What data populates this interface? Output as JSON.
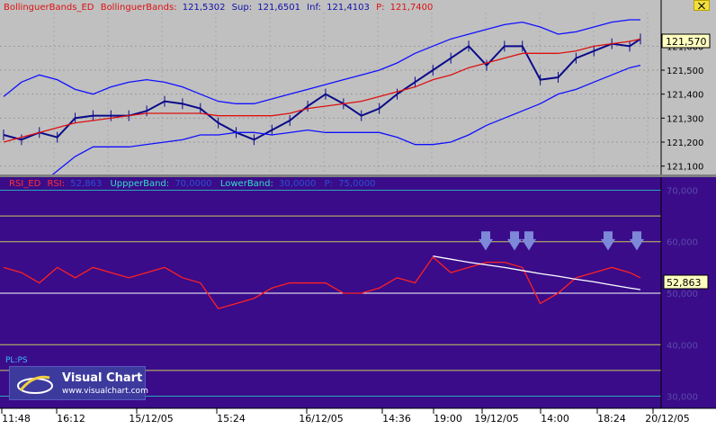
{
  "upper_panel": {
    "legend": {
      "indicator": "BollinguerBands_ED",
      "name": "BollinguerBands:",
      "value": "121,5302",
      "sup_label": "Sup:",
      "sup_value": "121,6501",
      "inf_label": "Inf:",
      "inf_value": "121,4103",
      "p_label": "P:",
      "p_value": "121,7400"
    },
    "price_tag": "121,570",
    "y_ticks": [
      "121,600",
      "121,500",
      "121,400",
      "121,300",
      "121,200",
      "121,100"
    ]
  },
  "lower_panel": {
    "legend": {
      "indicator": "RSI_ED",
      "name": "RSI:",
      "value": "52,863",
      "upper_label": "UppperBand:",
      "upper_value": "70,0000",
      "lower_label": "LowerBand:",
      "lower_value": "30,0000",
      "p_label": "P:",
      "p_value": "75,0000"
    },
    "value_tag": "52,863",
    "y_ticks": [
      "70,000",
      "60,000",
      "50,000",
      "40,000",
      "30,000"
    ],
    "pl_label": "PL:PS"
  },
  "x_ticks": [
    "11:48",
    "16:12",
    "15/12/05",
    "15:24",
    "16/12/05",
    "14:36",
    "19:00",
    "19/12/05",
    "14:00",
    "18:24",
    "20/12/05"
  ],
  "logo": {
    "title": "Visual Chart",
    "url": "www.visualchart.com"
  },
  "colors": {
    "upper_bg": "#c0c0c0",
    "lower_bg": "#3a0c8a",
    "price": "#0a0a8a",
    "bands": "#1010ff",
    "mid": "#dd1010",
    "rsi": "#ff2020",
    "level_gold": "#c8c860",
    "level_white": "#ffffff",
    "level_cyan": "#2aa8b8",
    "trend": "#ffffff",
    "arrow": "#7d88d8",
    "tag_bg": "#ffffc0"
  },
  "chart_data": [
    {
      "type": "line",
      "title": "BollinguerBands_ED",
      "ylim": [
        121.08,
        121.74
      ],
      "x": [
        0,
        20,
        40,
        60,
        80,
        100,
        120,
        140,
        160,
        180,
        200,
        220,
        240,
        260,
        280,
        300,
        320,
        340,
        360,
        380,
        400,
        420,
        440,
        460,
        480,
        500,
        520,
        540,
        560,
        580,
        600,
        620,
        640,
        660,
        680,
        700,
        712
      ],
      "series": [
        {
          "name": "Price",
          "values": [
            121.23,
            121.21,
            121.24,
            121.22,
            121.3,
            121.31,
            121.31,
            121.31,
            121.33,
            121.37,
            121.36,
            121.34,
            121.28,
            121.24,
            121.21,
            121.25,
            121.29,
            121.35,
            121.4,
            121.36,
            121.31,
            121.34,
            121.4,
            121.45,
            121.5,
            121.55,
            121.6,
            121.52,
            121.6,
            121.6,
            121.46,
            121.47,
            121.55,
            121.58,
            121.61,
            121.6,
            121.63
          ]
        },
        {
          "name": "Sup",
          "values": [
            121.39,
            121.45,
            121.48,
            121.46,
            121.42,
            121.4,
            121.43,
            121.45,
            121.46,
            121.45,
            121.43,
            121.4,
            121.37,
            121.36,
            121.36,
            121.38,
            121.4,
            121.42,
            121.44,
            121.46,
            121.48,
            121.5,
            121.53,
            121.57,
            121.6,
            121.63,
            121.65,
            121.67,
            121.69,
            121.7,
            121.68,
            121.65,
            121.66,
            121.68,
            121.7,
            121.71,
            121.71
          ]
        },
        {
          "name": "Mid",
          "values": [
            121.2,
            121.22,
            121.24,
            121.26,
            121.28,
            121.29,
            121.3,
            121.31,
            121.32,
            121.32,
            121.32,
            121.32,
            121.31,
            121.31,
            121.31,
            121.31,
            121.32,
            121.34,
            121.35,
            121.36,
            121.37,
            121.39,
            121.41,
            121.43,
            121.46,
            121.48,
            121.51,
            121.53,
            121.55,
            121.57,
            121.57,
            121.57,
            121.58,
            121.6,
            121.61,
            121.62,
            121.63
          ]
        },
        {
          "name": "Inf",
          "values": [
            121.01,
            121.0,
            121.02,
            121.08,
            121.14,
            121.18,
            121.18,
            121.18,
            121.19,
            121.2,
            121.21,
            121.23,
            121.23,
            121.24,
            121.24,
            121.23,
            121.24,
            121.25,
            121.24,
            121.24,
            121.24,
            121.24,
            121.22,
            121.19,
            121.19,
            121.2,
            121.23,
            121.27,
            121.3,
            121.33,
            121.36,
            121.4,
            121.42,
            121.45,
            121.48,
            121.51,
            121.52
          ]
        }
      ]
    },
    {
      "type": "line",
      "title": "RSI_ED",
      "ylim": [
        28,
        72
      ],
      "x": [
        0,
        20,
        40,
        60,
        80,
        100,
        120,
        140,
        160,
        180,
        200,
        220,
        240,
        260,
        280,
        300,
        320,
        340,
        360,
        380,
        400,
        420,
        440,
        460,
        480,
        500,
        520,
        540,
        560,
        580,
        600,
        620,
        640,
        660,
        680,
        700,
        712
      ],
      "series": [
        {
          "name": "RSI",
          "values": [
            55,
            54,
            52,
            55,
            53,
            55,
            54,
            53,
            54,
            55,
            53,
            52,
            47,
            48,
            49,
            51,
            52,
            52,
            52,
            50,
            50,
            51,
            53,
            52,
            57,
            54,
            55,
            56,
            56,
            55,
            48,
            50,
            53,
            54,
            55,
            54,
            53
          ]
        },
        {
          "name": "Trend",
          "values": [
            null,
            null,
            null,
            null,
            null,
            null,
            null,
            null,
            null,
            null,
            null,
            null,
            null,
            null,
            null,
            null,
            null,
            null,
            null,
            null,
            null,
            null,
            null,
            null,
            57.2,
            56.6,
            56.0,
            55.5,
            55.0,
            54.4,
            53.8,
            53.3,
            52.7,
            52.2,
            51.6,
            51.0,
            50.7
          ]
        }
      ],
      "levels": [
        70,
        65,
        60,
        50,
        40,
        35,
        30
      ]
    }
  ]
}
